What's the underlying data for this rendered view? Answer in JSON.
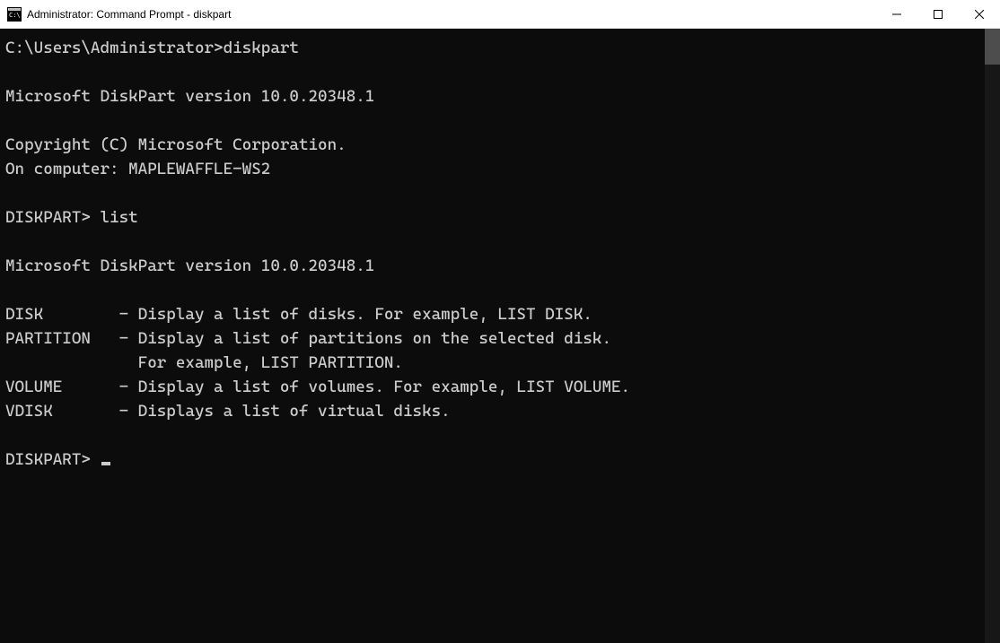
{
  "window": {
    "title": "Administrator: Command Prompt - diskpart"
  },
  "terminal": {
    "prompt1_path": "C:\\Users\\Administrator>",
    "prompt1_cmd": "diskpart",
    "version1": "Microsoft DiskPart version 10.0.20348.1",
    "copyright": "Copyright (C) Microsoft Corporation.",
    "computer": "On computer: MAPLEWAFFLE-WS2",
    "prompt2": "DISKPART> ",
    "prompt2_cmd": "list",
    "version2": "Microsoft DiskPart version 10.0.20348.1",
    "help_disk": "DISK        - Display a list of disks. For example, LIST DISK.",
    "help_partition": "PARTITION   - Display a list of partitions on the selected disk.",
    "help_partition2": "              For example, LIST PARTITION.",
    "help_volume": "VOLUME      - Display a list of volumes. For example, LIST VOLUME.",
    "help_vdisk": "VDISK       - Displays a list of virtual disks.",
    "prompt3": "DISKPART> "
  }
}
